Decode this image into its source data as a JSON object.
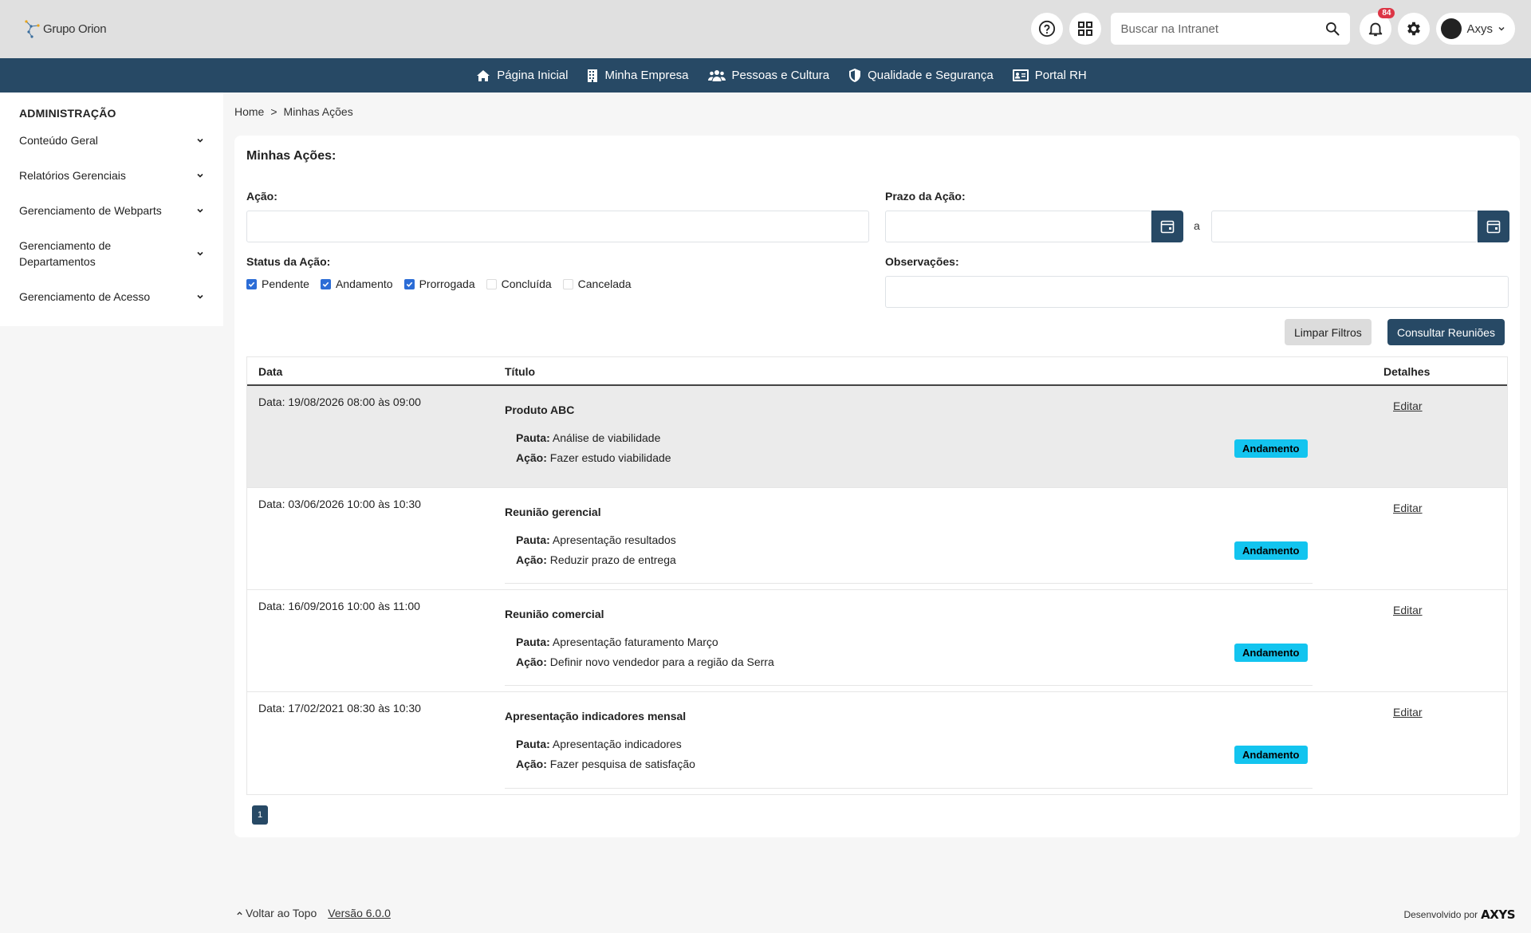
{
  "brand": {
    "name": "Grupo Orion"
  },
  "topbar": {
    "search_placeholder": "Buscar na Intranet",
    "notifications_count": "84",
    "user_name": "Axys"
  },
  "nav": {
    "items": [
      {
        "label": "Página Inicial",
        "icon": "home-icon"
      },
      {
        "label": "Minha Empresa",
        "icon": "building-icon"
      },
      {
        "label": "Pessoas e Cultura",
        "icon": "users-icon"
      },
      {
        "label": "Qualidade e Segurança",
        "icon": "shield-icon"
      },
      {
        "label": "Portal RH",
        "icon": "id-card-icon"
      }
    ]
  },
  "sidebar": {
    "title": "ADMINISTRAÇÃO",
    "items": [
      {
        "label": "Conteúdo Geral"
      },
      {
        "label": "Relatórios Gerenciais"
      },
      {
        "label": "Gerenciamento de Webparts"
      },
      {
        "label": "Gerenciamento de Departamentos"
      },
      {
        "label": "Gerenciamento de Acesso"
      }
    ]
  },
  "breadcrumb": {
    "home": "Home",
    "separator": ">",
    "current": "Minhas Ações"
  },
  "main": {
    "title": "Minhas Ações:",
    "filters": {
      "acao_label": "Ação:",
      "prazo_label": "Prazo da Ação:",
      "prazo_sep": "a",
      "status_label": "Status da Ação:",
      "observacoes_label": "Observações:",
      "statuses": [
        {
          "label": "Pendente",
          "checked": true
        },
        {
          "label": "Andamento",
          "checked": true
        },
        {
          "label": "Prorrogada",
          "checked": true
        },
        {
          "label": "Concluída",
          "checked": false
        },
        {
          "label": "Cancelada",
          "checked": false
        }
      ]
    },
    "buttons": {
      "clear": "Limpar Filtros",
      "search": "Consultar Reuniões"
    },
    "table": {
      "headers": {
        "date": "Data",
        "title": "Título",
        "details": "Detalhes"
      },
      "pauta_label": "Pauta:",
      "acao_label": "Ação:",
      "edit_label": "Editar",
      "rows": [
        {
          "date": "Data: 19/08/2026 08:00 às 09:00",
          "title": "Produto ABC",
          "pauta": "Análise de viabilidade",
          "acao": "Fazer estudo viabilidade",
          "status": "Andamento"
        },
        {
          "date": "Data: 03/06/2026 10:00 às 10:30",
          "title": "Reunião gerencial",
          "pauta": "Apresentação resultados",
          "acao": "Reduzir prazo de entrega",
          "status": "Andamento"
        },
        {
          "date": "Data: 16/09/2016 10:00 às 11:00",
          "title": "Reunião comercial",
          "pauta": "Apresentação faturamento Março",
          "acao": "Definir novo vendedor para a região da Serra",
          "status": "Andamento"
        },
        {
          "date": "Data: 17/02/2021 08:30 às 10:30",
          "title": "Apresentação indicadores mensal",
          "pauta": "Apresentação indicadores",
          "acao": "Fazer pesquisa de satisfação",
          "status": "Andamento"
        }
      ]
    },
    "pagination": {
      "current": "1"
    }
  },
  "footer": {
    "back_to_top": "Voltar ao Topo",
    "version": "Versão 6.0.0",
    "developed_by": "Desenvolvido por",
    "developer_logo": "AXYS"
  },
  "colors": {
    "primary": "#274965",
    "status": "#13c4ef",
    "badge": "#dc3545"
  }
}
